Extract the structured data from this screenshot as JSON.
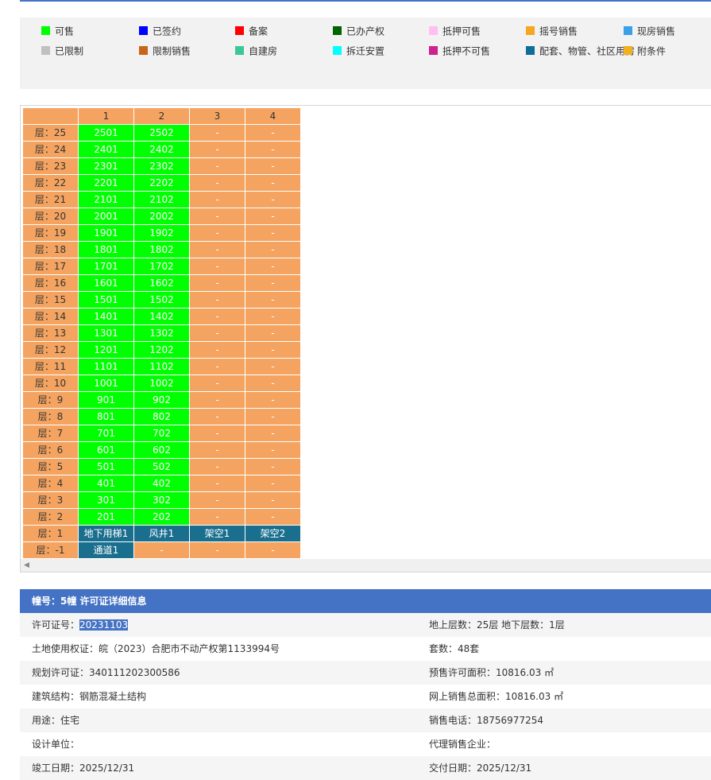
{
  "legend": {
    "row1": [
      {
        "label": "可售",
        "color": "#00ff00"
      },
      {
        "label": "已签约",
        "color": "#0000ff"
      },
      {
        "label": "备案",
        "color": "#ff0000"
      },
      {
        "label": "已办产权",
        "color": "#006400"
      },
      {
        "label": "抵押可售",
        "color": "#ffc0f0"
      },
      {
        "label": "摇号销售",
        "color": "#f5a623"
      },
      {
        "label": "现房销售",
        "color": "#3aa0e8"
      }
    ],
    "row2": [
      {
        "label": "已限制",
        "color": "#c0c0c0"
      },
      {
        "label": "限制销售",
        "color": "#c8651b"
      },
      {
        "label": "自建房",
        "color": "#3cc896"
      },
      {
        "label": "拆迁安置",
        "color": "#00ffff"
      },
      {
        "label": "抵押不可售",
        "color": "#d02090"
      },
      {
        "label": "配套、物管、社区用房",
        "color": "#0e6e9a"
      },
      {
        "label": "附条件",
        "color": "#f0b020"
      }
    ]
  },
  "grid": {
    "columns": [
      "1",
      "2",
      "3",
      "4"
    ],
    "rows": [
      {
        "floor": "层：25",
        "cells": [
          "2501",
          "2502",
          "-",
          "-"
        ]
      },
      {
        "floor": "层：24",
        "cells": [
          "2401",
          "2402",
          "-",
          "-"
        ]
      },
      {
        "floor": "层：23",
        "cells": [
          "2301",
          "2302",
          "-",
          "-"
        ]
      },
      {
        "floor": "层：22",
        "cells": [
          "2201",
          "2202",
          "-",
          "-"
        ]
      },
      {
        "floor": "层：21",
        "cells": [
          "2101",
          "2102",
          "-",
          "-"
        ]
      },
      {
        "floor": "层：20",
        "cells": [
          "2001",
          "2002",
          "-",
          "-"
        ]
      },
      {
        "floor": "层：19",
        "cells": [
          "1901",
          "1902",
          "-",
          "-"
        ]
      },
      {
        "floor": "层：18",
        "cells": [
          "1801",
          "1802",
          "-",
          "-"
        ]
      },
      {
        "floor": "层：17",
        "cells": [
          "1701",
          "1702",
          "-",
          "-"
        ]
      },
      {
        "floor": "层：16",
        "cells": [
          "1601",
          "1602",
          "-",
          "-"
        ]
      },
      {
        "floor": "层：15",
        "cells": [
          "1501",
          "1502",
          "-",
          "-"
        ]
      },
      {
        "floor": "层：14",
        "cells": [
          "1401",
          "1402",
          "-",
          "-"
        ]
      },
      {
        "floor": "层：13",
        "cells": [
          "1301",
          "1302",
          "-",
          "-"
        ]
      },
      {
        "floor": "层：12",
        "cells": [
          "1201",
          "1202",
          "-",
          "-"
        ]
      },
      {
        "floor": "层：11",
        "cells": [
          "1101",
          "1102",
          "-",
          "-"
        ]
      },
      {
        "floor": "层：10",
        "cells": [
          "1001",
          "1002",
          "-",
          "-"
        ]
      },
      {
        "floor": "层：9",
        "cells": [
          "901",
          "902",
          "-",
          "-"
        ]
      },
      {
        "floor": "层：8",
        "cells": [
          "801",
          "802",
          "-",
          "-"
        ]
      },
      {
        "floor": "层：7",
        "cells": [
          "701",
          "702",
          "-",
          "-"
        ]
      },
      {
        "floor": "层：6",
        "cells": [
          "601",
          "602",
          "-",
          "-"
        ]
      },
      {
        "floor": "层：5",
        "cells": [
          "501",
          "502",
          "-",
          "-"
        ]
      },
      {
        "floor": "层：4",
        "cells": [
          "401",
          "402",
          "-",
          "-"
        ]
      },
      {
        "floor": "层：3",
        "cells": [
          "301",
          "302",
          "-",
          "-"
        ]
      },
      {
        "floor": "层：2",
        "cells": [
          "201",
          "202",
          "-",
          "-"
        ]
      },
      {
        "floor": "层：1",
        "cells": [
          "地下用梯1",
          "风井1",
          "架空1",
          "架空2"
        ]
      },
      {
        "floor": "层：-1",
        "cells": [
          "通道1",
          "-",
          "-",
          "-"
        ]
      }
    ]
  },
  "info": {
    "title": "幢号：5幢 许可证详细信息",
    "permit_label": "许可证号：",
    "permit_value": "20231103",
    "floors": "地上层数：25层  地下层数：1层",
    "land": "土地使用权证：皖（2023）合肥市不动产权第1133994号",
    "units": "套数：48套",
    "planning": "规划许可证：340111202300586",
    "presale_area": "预售许可面积：10816.03 ㎡",
    "structure": "建筑结构：钢筋混凝土结构",
    "online_area": "网上销售总面积：10816.03 ㎡",
    "usage": "用途：住宅",
    "phone": "销售电话：18756977254",
    "designer": "设计单位：",
    "agent": "代理销售企业：",
    "completion": "竣工日期：2025/12/31",
    "delivery": "交付日期：2025/12/31"
  }
}
